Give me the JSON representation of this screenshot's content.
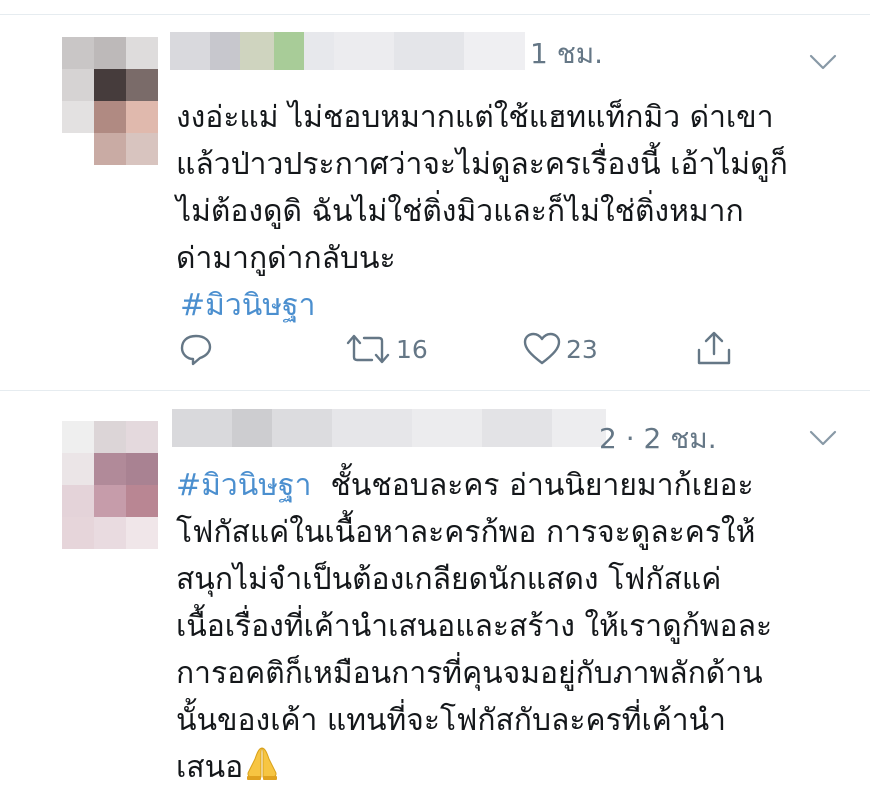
{
  "colors": {
    "text": "#14171a",
    "meta": "#657786",
    "hashtag": "#4b8fcf",
    "divider": "#e6ecf0"
  },
  "tweets": [
    {
      "time": "1 ชม.",
      "lines": [
        "งงอ่ะแม่ ไม่ชอบหมากแต่ใช้แฮทแท็กมิว ด่าเขา",
        "แล้วป่าวประกาศว่าจะไม่ดูละครเรื่องนี้ เอ้าไม่ดูก็",
        "ไม่ต้องดูดิ ฉันไม่ใช่ติ่งมิวและก็ไม่ใช่ติ่งหมาก",
        "ด่ามากูด่ากลับนะ"
      ],
      "hashtag": "#มิวนิษฐา",
      "reply_icon": "reply-icon",
      "retweet_icon": "retweet-icon",
      "retweet_count": "16",
      "like_icon": "heart-icon",
      "like_count": "23",
      "share_icon": "share-icon",
      "menu_icon": "chevron-down-icon"
    },
    {
      "time": "2 · 2 ชม.",
      "hashtag": "#มิวนิษฐา",
      "first_line_rest": "  ชั้นชอบละคร อ่านนิยายมาก้เยอะ",
      "lines": [
        "โฟกัสแค่ในเนื้อหาละครก้พอ การจะดูละครให้",
        "สนุกไม่จำเป็นต้องเกลียดนักแสดง โฟกัสแค่",
        "เนื้อเรื่องที่เค้านำเสนอและสร้าง ให้เราดูก้พอละ",
        "การอคติก็เหมือนการที่คุนจมอยู่กับภาพลักด้าน",
        "นั้นของเค้า แทนที่จะโฟกัสกับละครที่เค้านำ"
      ],
      "last_line": "เสนอ",
      "last_emoji": "folded-hands-emoji",
      "menu_icon": "chevron-down-icon"
    }
  ]
}
